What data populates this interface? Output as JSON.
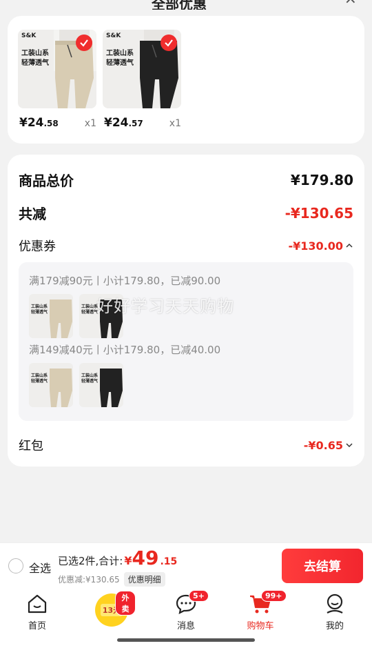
{
  "header": {
    "title": "全部优惠",
    "close_label": "×"
  },
  "products": [
    {
      "brand": "S&K",
      "tag_line1": "工装山系",
      "tag_line2": "轻薄透气",
      "color": "khaki",
      "price_int": "¥24",
      "price_dec": ".58",
      "qty": "x1"
    },
    {
      "brand": "S&K",
      "tag_line1": "工装山系",
      "tag_line2": "轻薄透气",
      "color": "black",
      "price_int": "¥24",
      "price_dec": ".57",
      "qty": "x1"
    }
  ],
  "summary": {
    "total_label": "商品总价",
    "total_value": "¥179.80",
    "reduce_label": "共减",
    "reduce_value": "-¥130.65",
    "coupon_label": "优惠券",
    "coupon_value": "-¥130.00",
    "coupon_groups": [
      {
        "text": "满179减90元丨小计179.80，已减90.00"
      },
      {
        "text": "满149减40元丨小计179.80，已减40.00"
      }
    ],
    "redpack_label": "红包",
    "redpack_value": "-¥0.65"
  },
  "watermark": "好好学习天天购物",
  "checkout": {
    "select_all": "全选",
    "selected_text": "已选2件,合计:",
    "currency": "¥",
    "amount_int": "49",
    "amount_dec": ".15",
    "discount_text": "优惠减:¥130.65",
    "detail_label": "优惠明细",
    "submit_label": "去结算"
  },
  "tabbar": {
    "tabs": [
      {
        "label": "首页",
        "icon": "home-icon"
      },
      {
        "label": "",
        "icon": "takeout-coupon-icon",
        "badge": "外卖",
        "coupon": "13元"
      },
      {
        "label": "消息",
        "icon": "message-icon",
        "badge": "5+"
      },
      {
        "label": "购物车",
        "icon": "cart-icon",
        "badge": "99+"
      },
      {
        "label": "我的",
        "icon": "profile-icon"
      }
    ]
  },
  "colors": {
    "accent_red": "#e8281f",
    "checkout_button": "#f2262e",
    "background": "#f2f2f2"
  }
}
